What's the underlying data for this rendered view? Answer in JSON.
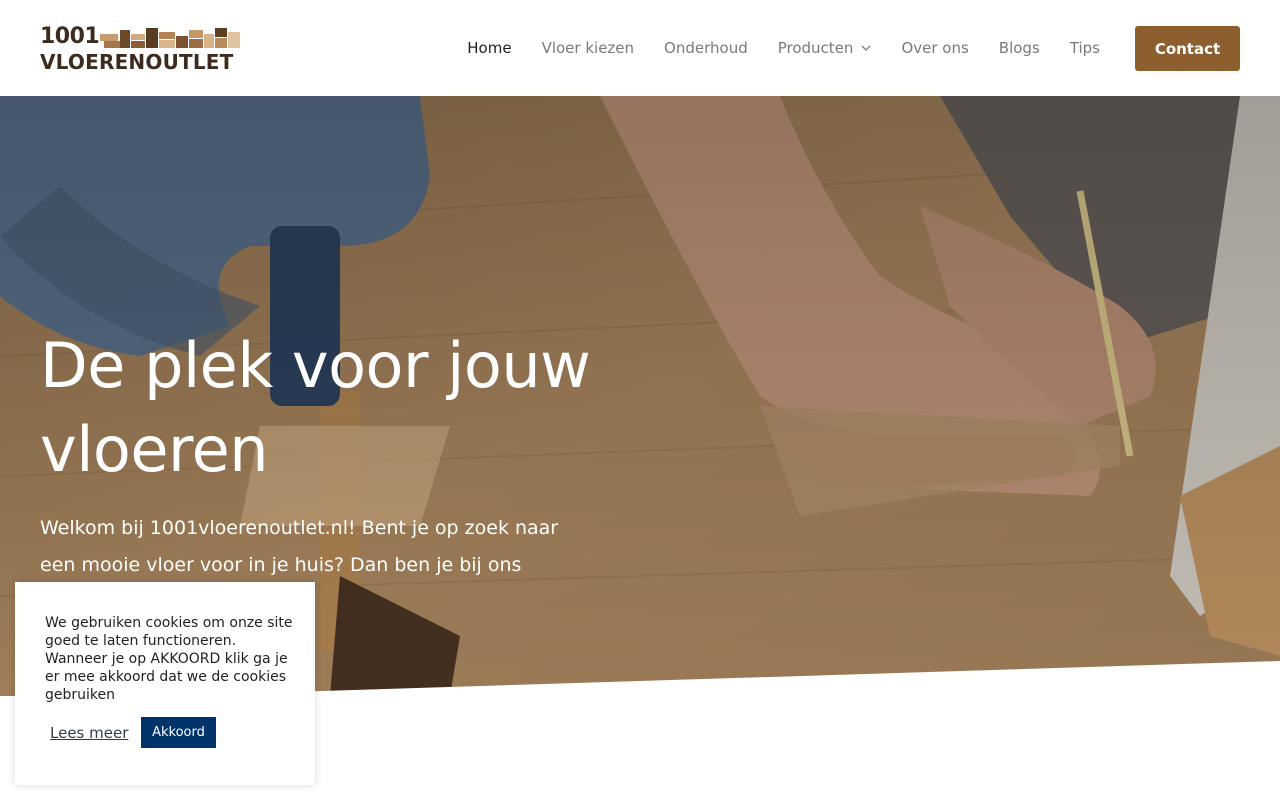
{
  "logo": {
    "number": "1001",
    "word": "VLOERENOUTLET",
    "icon": "wood-tiles-logo"
  },
  "nav": {
    "items": [
      {
        "label": "Home",
        "active": true
      },
      {
        "label": "Vloer kiezen"
      },
      {
        "label": "Onderhoud"
      },
      {
        "label": "Producten",
        "has_dropdown": true,
        "icon": "chevron-down-icon"
      },
      {
        "label": "Over ons"
      },
      {
        "label": "Blogs"
      },
      {
        "label": "Tips"
      }
    ],
    "contact_label": "Contact"
  },
  "hero": {
    "title_line1": "De plek voor jouw",
    "title_line2": "vloeren",
    "subtitle": "Welkom bij 1001vloerenoutlet.nl! Bent je op zoek naar een mooie vloer voor in je huis? Dan ben je bij ons aan"
  },
  "cookie": {
    "text": "We gebruiken cookies om onze site goed te laten functioneren. Wanneer je op AKKOORD klik ga je er mee akkoord dat we de cookies gebruiken",
    "read_more": "Lees meer",
    "accept": "Akkoord"
  },
  "colors": {
    "brand_brown": "#8e5f2e",
    "logo_dark": "#3d2b1f",
    "cookie_button": "#003369",
    "nav_text": "#7a7a7a",
    "nav_active": "#1f1f1f"
  }
}
